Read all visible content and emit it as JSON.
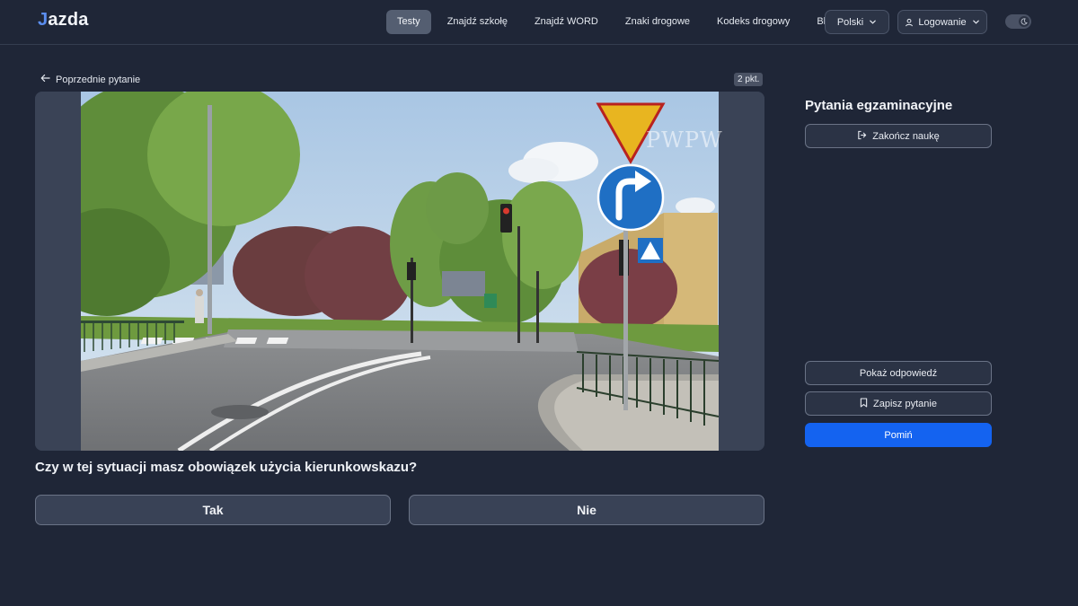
{
  "app": {
    "logo_mark": "J",
    "logo_rest": "azda"
  },
  "nav": {
    "items": [
      {
        "label": "Testy",
        "active": true
      },
      {
        "label": "Znajdź szkołę",
        "active": false
      },
      {
        "label": "Znajdź WORD",
        "active": false
      },
      {
        "label": "Znaki drogowe",
        "active": false
      },
      {
        "label": "Kodeks drogowy",
        "active": false
      },
      {
        "label": "Blog",
        "active": false
      }
    ],
    "language": "Polski",
    "login": "Logowanie",
    "theme_toggle_icon": "moon-icon"
  },
  "question": {
    "back_label": "Poprzednie pytanie",
    "points": "2 pkt.",
    "watermark": "PWPW",
    "text": "Czy w tej sytuacji masz obowiązek użycia kierunkowskazu?",
    "answers": [
      "Tak",
      "Nie"
    ]
  },
  "sidebar": {
    "title": "Pytania egzaminacyjne",
    "end_label": "Zakończ naukę",
    "show_answer_label": "Pokaż odpowiedź",
    "save_label": "Zapisz pytanie",
    "skip_label": "Pomiń"
  },
  "colors": {
    "background": "#1f2637",
    "accent": "#1463f0",
    "logo_accent": "#5b8ef0"
  }
}
